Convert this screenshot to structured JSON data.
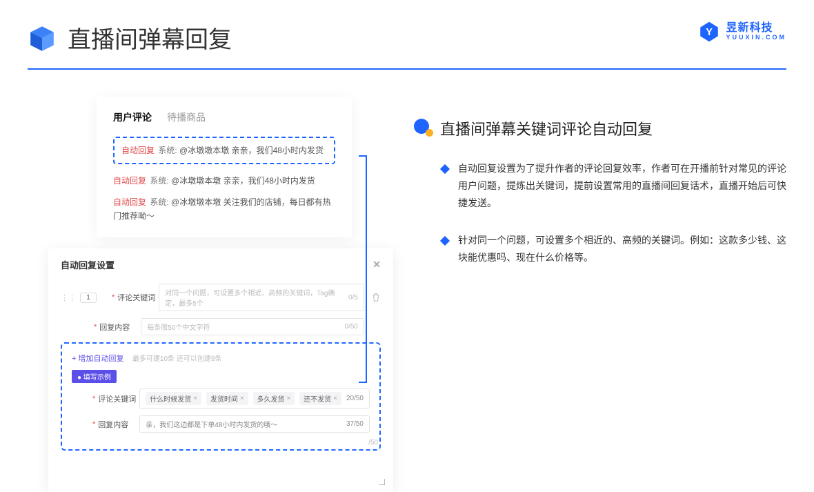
{
  "header": {
    "title": "直播间弹幕回复"
  },
  "brand": {
    "name": "昱新科技",
    "sub": "YUUXIN.COM"
  },
  "commentCard": {
    "tabs": {
      "active": "用户评论",
      "other": "待播商品"
    },
    "highlighted": {
      "badge": "自动回复",
      "sys": "系统:",
      "text": "@冰墩墩本墩 亲亲，我们48小时内发货"
    },
    "lines": [
      {
        "badge": "自动回复",
        "sys": "系统:",
        "text": "@冰墩墩本墩 亲亲，我们48小时内发货"
      },
      {
        "badge": "自动回复",
        "sys": "系统:",
        "text": "@冰墩墩本墩 关注我们的店铺，每日都有热门推荐呦～"
      }
    ]
  },
  "settings": {
    "title": "自动回复设置",
    "num": "1",
    "row1": {
      "label": "评论关键词",
      "placeholder": "对同一个问题，可设置多个相近、高频的关键词，Tag确定，最多5个",
      "count": "0/5"
    },
    "row2": {
      "label": "回复内容",
      "placeholder": "每条限50个中文字符",
      "count": "0/50"
    },
    "addLink": "+ 增加自动回复",
    "addTip": "最多可建10条 还可以创建9条",
    "exampleTag": "● 填写示例",
    "ex1": {
      "label": "评论关键词",
      "tags": [
        "什么时候发货",
        "发货时间",
        "多久发货",
        "还不发货"
      ],
      "count": "20/50"
    },
    "ex2": {
      "label": "回复内容",
      "text": "亲，我们这边都是下单48小时内发货的哦～",
      "count": "37/50"
    },
    "bottomCount": "/50"
  },
  "right": {
    "title": "直播间弹幕关键词评论自动回复",
    "bullets": [
      "自动回复设置为了提升作者的评论回复效率，作者可在开播前针对常见的评论用户问题，提炼出关键词，提前设置常用的直播间回复话术，直播开始后可快捷发送。",
      "针对同一个问题，可设置多个相近的、高频的关键词。例如：这款多少钱、这块能优惠吗、现在什么价格等。"
    ]
  }
}
